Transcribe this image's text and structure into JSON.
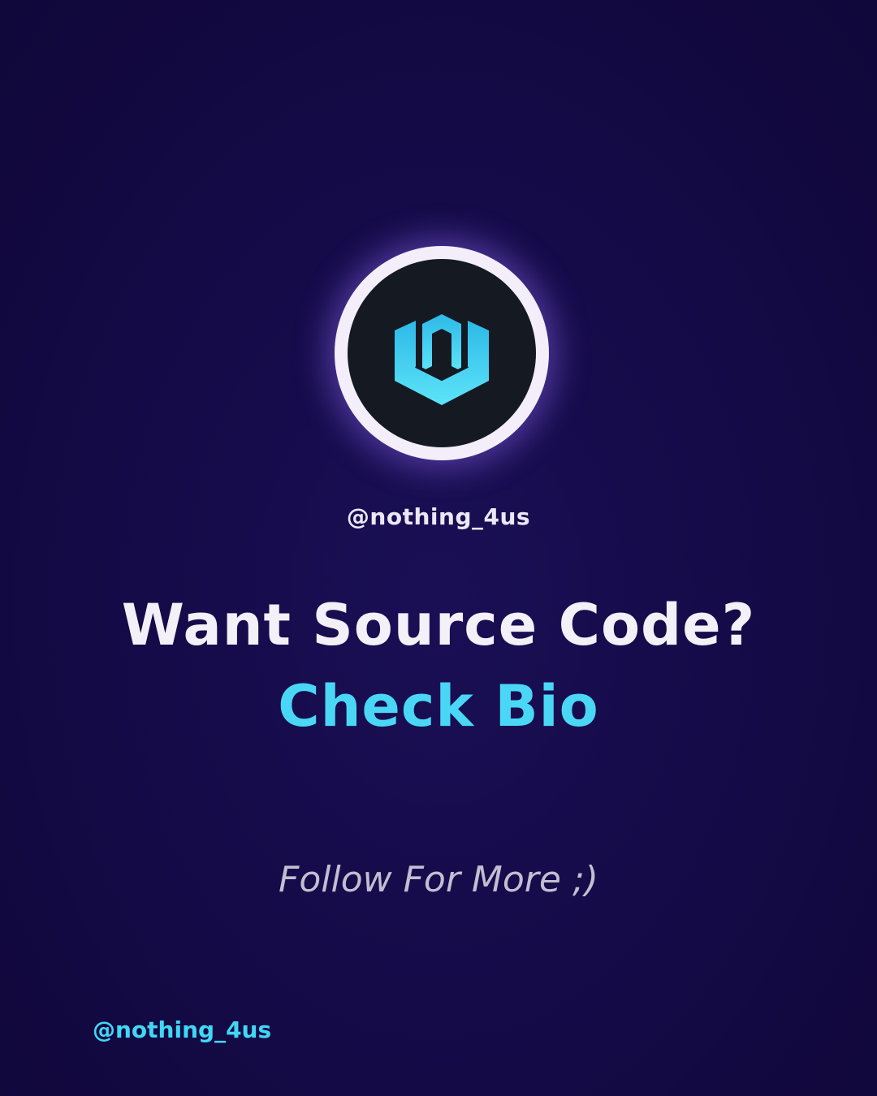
{
  "logo": {
    "icon": "shield-n-icon",
    "accent_color": "#4fd6f6"
  },
  "profile": {
    "handle": "@nothing_4us"
  },
  "headline": {
    "primary": "Want Source Code?",
    "secondary": "Check Bio",
    "secondary_color": "#4ad7f6"
  },
  "cta": {
    "follow": "Follow For More ;)"
  },
  "footer": {
    "handle": "@nothing_4us",
    "color": "#41d7f4"
  }
}
